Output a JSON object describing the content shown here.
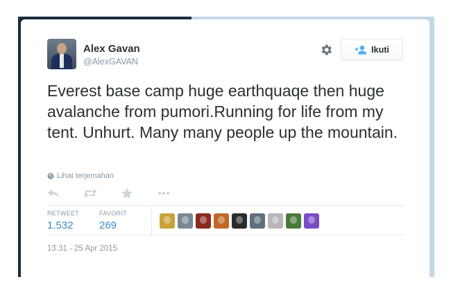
{
  "user": {
    "name": "Alex Gavan",
    "handle": "@AlexGAVAN"
  },
  "header": {
    "follow_label": "Ikuti",
    "settings_icon": "gear-icon",
    "follow_icon": "add-user-icon"
  },
  "tweet": {
    "text": "Everest base camp huge earthquaqe then huge avalanche from pumori.Running for life from my tent. Unhurt. Many many people up the mountain.",
    "translate_label": "Lihat terjemahan",
    "translate_icon": "globe-icon"
  },
  "actions": [
    {
      "name": "reply-icon"
    },
    {
      "name": "retweet-icon"
    },
    {
      "name": "favorite-icon"
    },
    {
      "name": "more-icon"
    }
  ],
  "stats": {
    "retweet_label": "RETWEET",
    "retweet_count": "1.532",
    "favorite_label": "FAVORIT",
    "favorite_count": "269"
  },
  "favoriters": [
    {
      "color": "#c9a23a"
    },
    {
      "color": "#7a8894"
    },
    {
      "color": "#8a2a1e"
    },
    {
      "color": "#c2662a"
    },
    {
      "color": "#2b2b2b"
    },
    {
      "color": "#5e6f7d"
    },
    {
      "color": "#b7b7b7"
    },
    {
      "color": "#4a7a3a"
    },
    {
      "color": "#7b4bc4"
    }
  ],
  "timestamp": "13.31 - 25 Apr 2015",
  "colors": {
    "link": "#3b88c3",
    "muted": "#8899a6",
    "text": "#292f33"
  }
}
